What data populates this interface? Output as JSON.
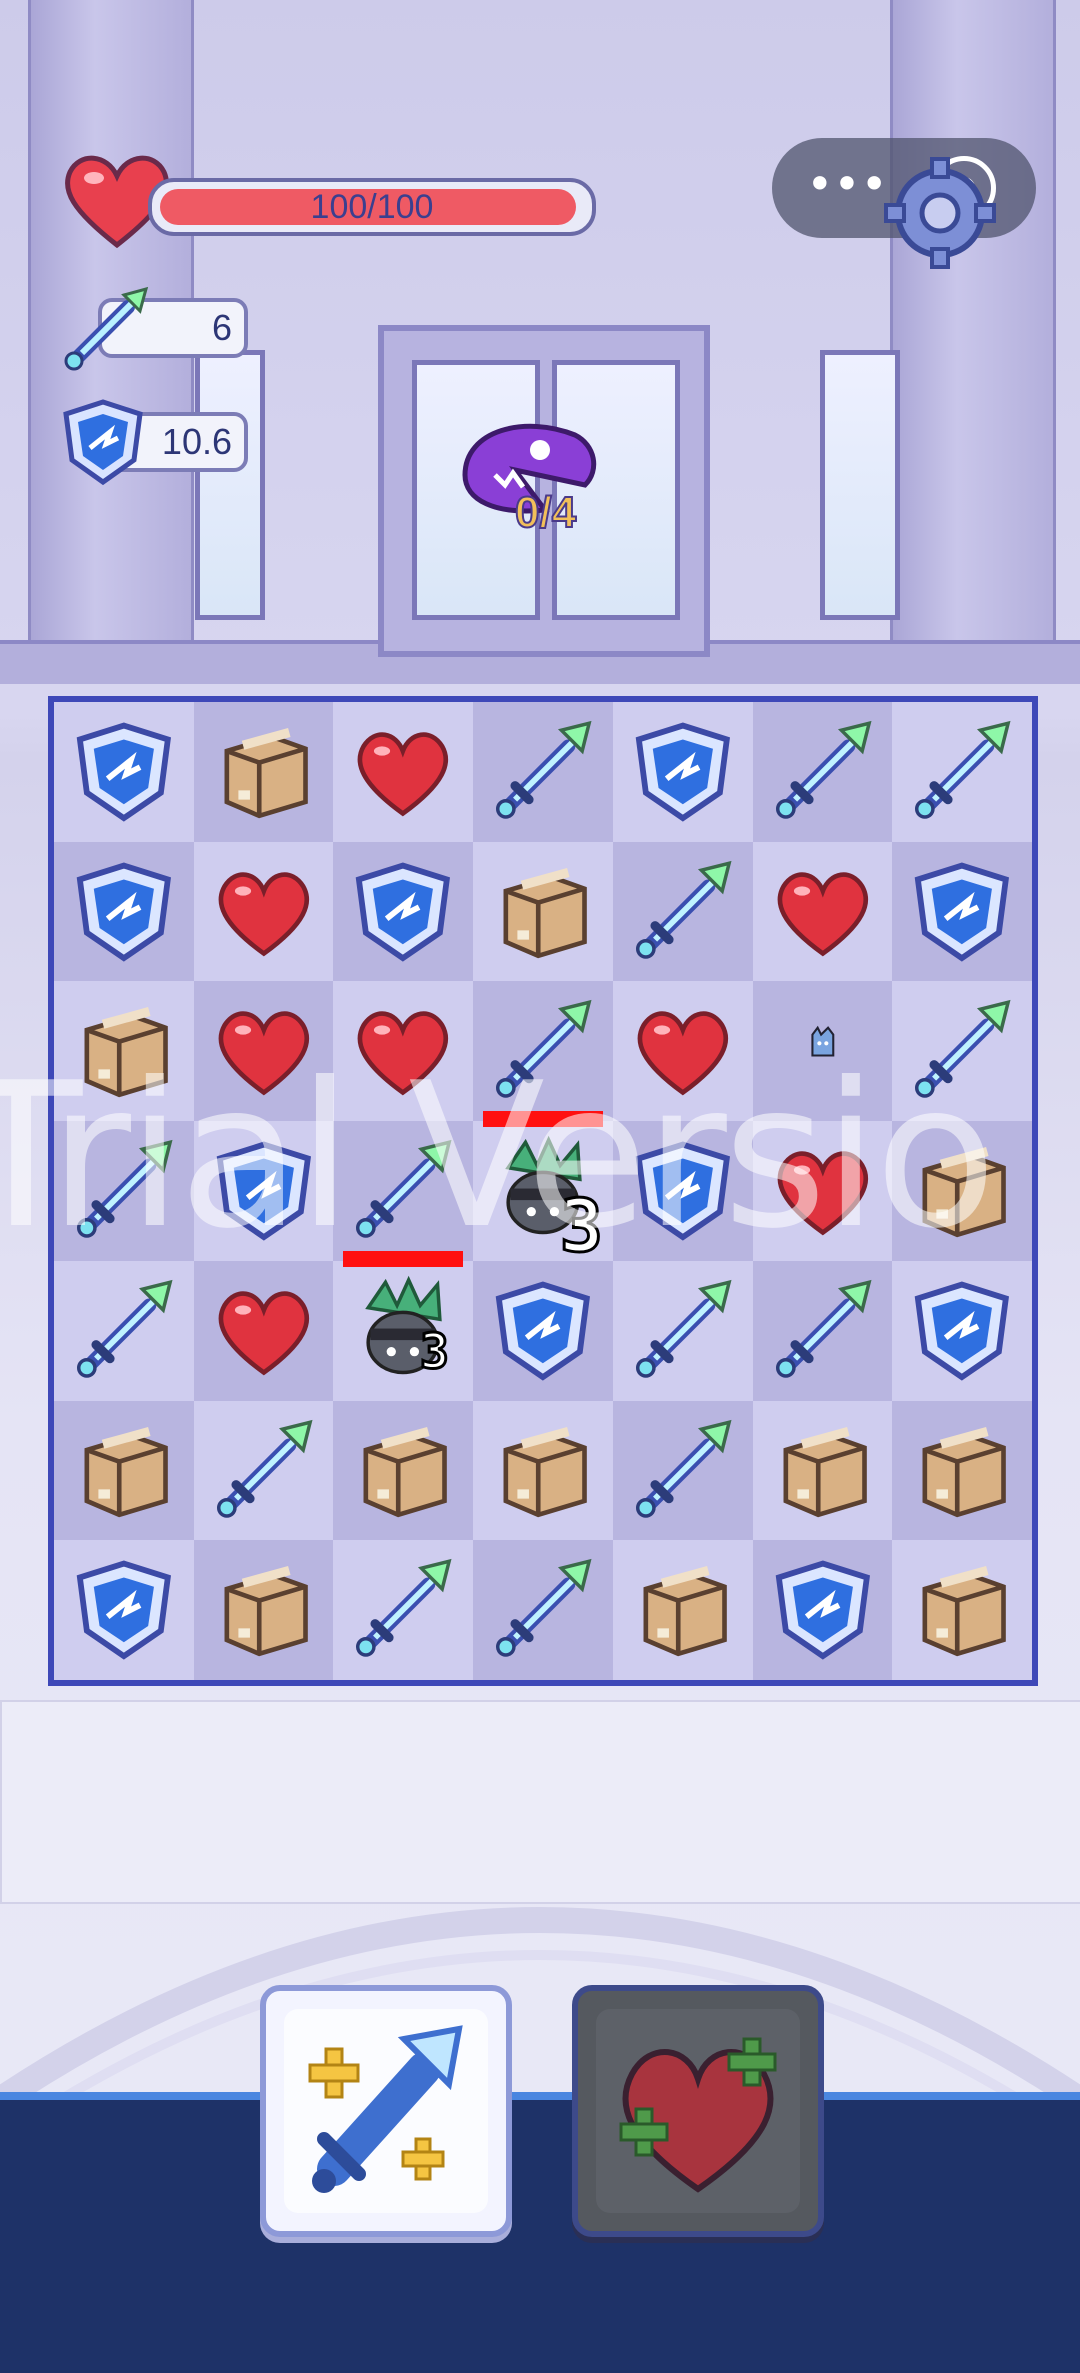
{
  "hud": {
    "hp_text": "100/100",
    "hp_fraction": 1.0,
    "attack_value": "6",
    "defense_value": "10.6",
    "wave_counter": "0/4",
    "menu_icon": "more-dots-icon",
    "close_icon": "target-icon"
  },
  "board": {
    "rows": 7,
    "cols": 7,
    "grid": [
      [
        "shield",
        "box",
        "heart",
        "sword",
        "shield",
        "sword",
        "sword"
      ],
      [
        "shield",
        "heart",
        "shield",
        "box",
        "sword",
        "heart",
        "shield"
      ],
      [
        "box",
        "heart",
        "heart",
        "sword",
        "heart",
        "enemy-small",
        "sword"
      ],
      [
        "sword",
        "shield",
        "sword",
        "enemy",
        "shield",
        "heart",
        "box"
      ],
      [
        "sword",
        "heart",
        "enemy",
        "shield",
        "sword",
        "sword",
        "shield"
      ],
      [
        "box",
        "sword",
        "box",
        "box",
        "sword",
        "box",
        "box"
      ],
      [
        "shield",
        "box",
        "sword",
        "sword",
        "box",
        "shield",
        "box"
      ]
    ],
    "enemies": [
      {
        "label": "3"
      },
      {
        "label": "3"
      }
    ]
  },
  "watermark": "Trial Versio",
  "skills": {
    "attack_icon": "sword-plus-icon",
    "heal_icon": "heart-plus-icon"
  },
  "colors": {
    "hp": "#ef5a64",
    "board_border": "#3e48b8",
    "bottom_band": "#1e3268"
  }
}
